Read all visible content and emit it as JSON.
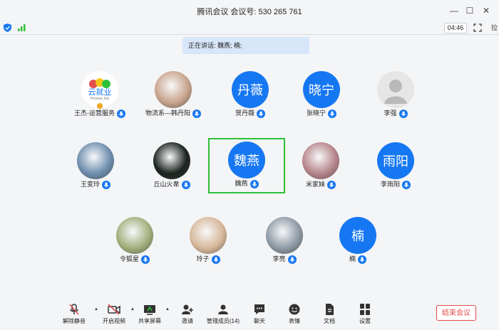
{
  "window": {
    "title": "腾讯会议 会议号: 530 265 761"
  },
  "status": {
    "timer": "04:46",
    "clipped_text": "拉"
  },
  "speaking": {
    "text": "正在讲话: 魏燕; 楠;"
  },
  "participants": [
    {
      "name": "王杰-运营服务",
      "avatar": "logo",
      "logo_text": "云就业",
      "logo_sub": "Precise Job"
    },
    {
      "name": "物流系—韩丹阳",
      "avatar": "photo",
      "photo_color": "#c9a58e"
    },
    {
      "name": "贺丹薇",
      "avatar": "text",
      "avatar_text": "丹薇"
    },
    {
      "name": "张晓宁",
      "avatar": "text",
      "avatar_text": "晓宁"
    },
    {
      "name": "李强",
      "avatar": "default"
    },
    {
      "name": "王变玲",
      "avatar": "photo",
      "photo_color": "#6f8fae"
    },
    {
      "name": "丘山火韋",
      "avatar": "photo",
      "photo_color": "#1d2520"
    },
    {
      "name": "魏燕",
      "avatar": "text",
      "avatar_text": "魏燕",
      "active": true
    },
    {
      "name": "米家妹",
      "avatar": "photo",
      "photo_color": "#b7868c"
    },
    {
      "name": "李雨阳",
      "avatar": "text",
      "avatar_text": "雨阳"
    },
    {
      "name": "令狐星",
      "avatar": "photo",
      "photo_color": "#a3b07d"
    },
    {
      "name": "玲子",
      "avatar": "photo",
      "photo_color": "#d7b89a"
    },
    {
      "name": "李亮",
      "avatar": "photo",
      "photo_color": "#8e9aa5"
    },
    {
      "name": "楠",
      "avatar": "text",
      "avatar_text": "楠"
    }
  ],
  "toolbar": {
    "mute": "解除静音",
    "video": "开启视频",
    "share": "共享屏幕",
    "invite": "邀请",
    "manage": "管理成员(14)",
    "chat": "聊天",
    "reaction": "表情",
    "docs": "文档",
    "settings": "设置",
    "end": "结束会议"
  },
  "colors": {
    "accent": "#1677f2",
    "active_border": "#2dc03a",
    "danger": "#e24c4c"
  }
}
